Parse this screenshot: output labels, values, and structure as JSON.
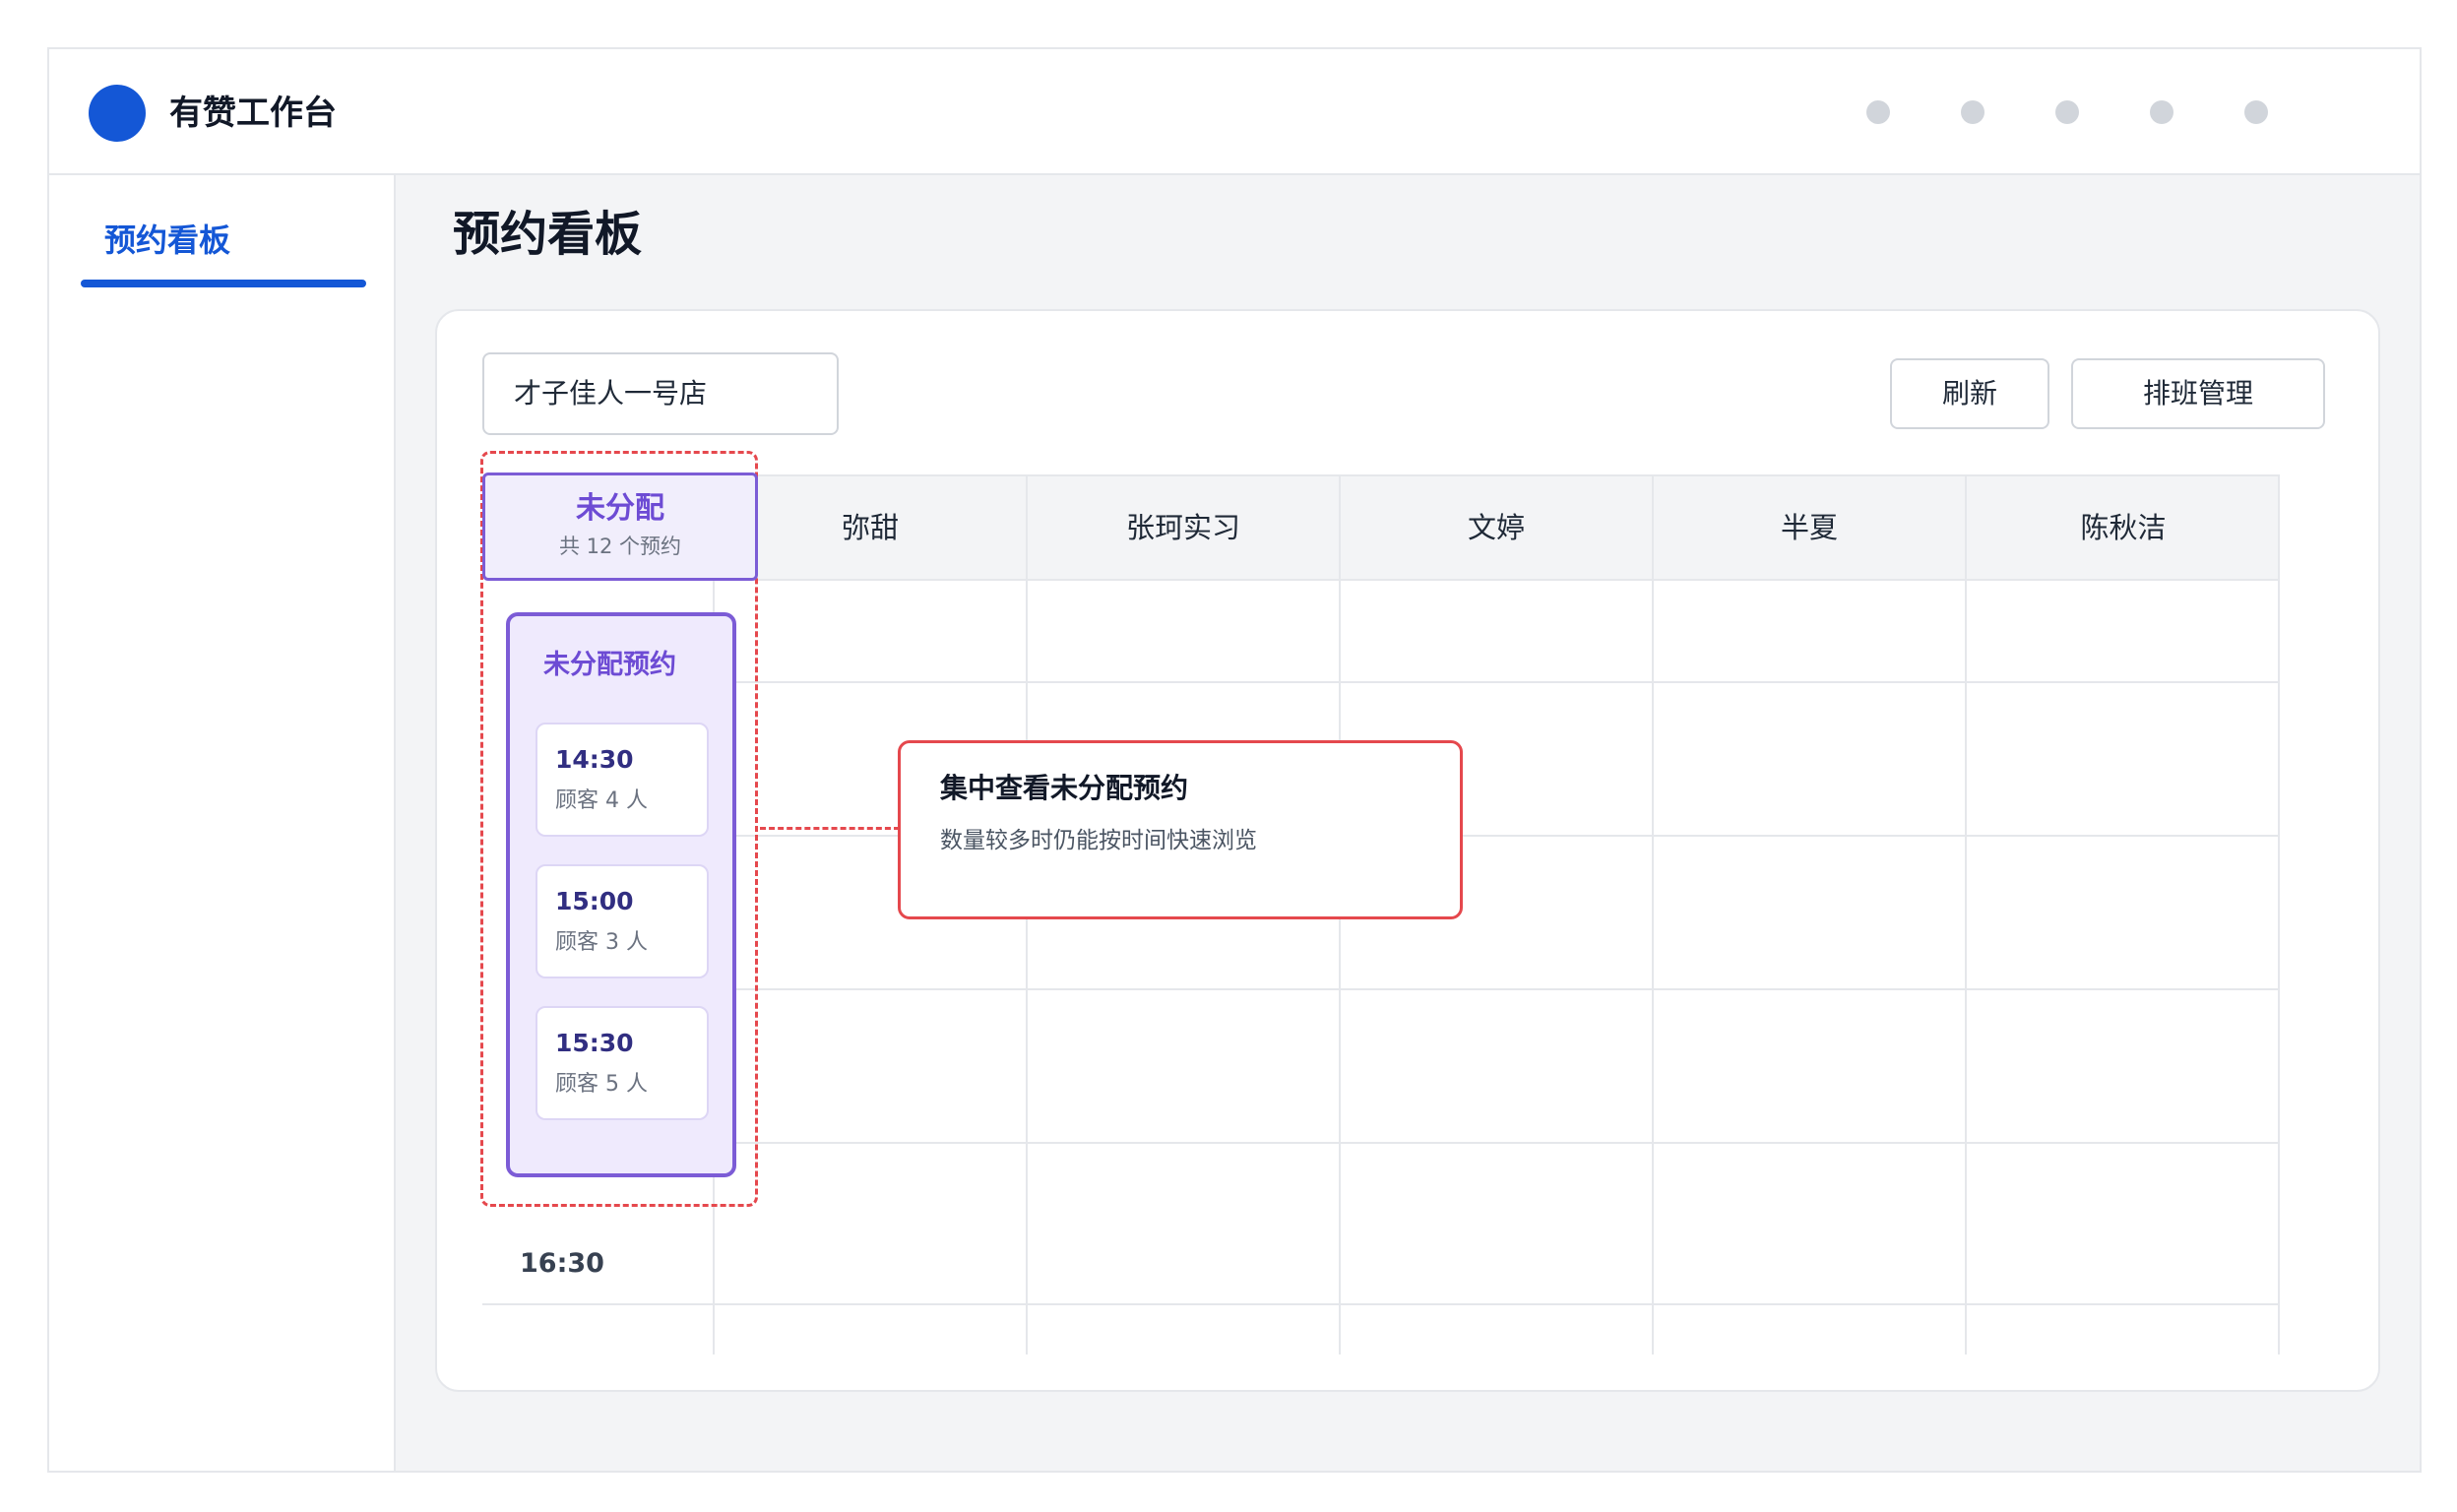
{
  "app": {
    "title": "有赞工作台",
    "brand_color": "#1457d6",
    "top_icons": [
      "nav-icon-1",
      "nav-icon-2",
      "nav-icon-3",
      "nav-icon-4",
      "nav-icon-5"
    ]
  },
  "sidebar": {
    "items": [
      {
        "label": "预约看板",
        "active": true
      }
    ]
  },
  "page": {
    "title": "预约看板"
  },
  "toolbar": {
    "store_value": "才子佳人一号店",
    "refresh_label": "刷新",
    "shift_label": "排班管理"
  },
  "board": {
    "unassigned": {
      "title": "未分配",
      "count_text": "共 12 个预约",
      "panel_title": "未分配预约",
      "accent_color": "#6d4bd4",
      "items": [
        {
          "time": "14:30",
          "guests": "顾客 4 人"
        },
        {
          "time": "15:00",
          "guests": "顾客 3 人"
        },
        {
          "time": "15:30",
          "guests": "顾客 5 人"
        }
      ]
    },
    "staff": [
      "弥甜",
      "张珂实习",
      "文婷",
      "半夏",
      "陈秋洁"
    ],
    "time_labels": [
      "16:30"
    ]
  },
  "callout": {
    "title": "集中查看未分配预约",
    "description": "数量较多时仍能按时间快速浏览",
    "color": "#e5484d"
  }
}
